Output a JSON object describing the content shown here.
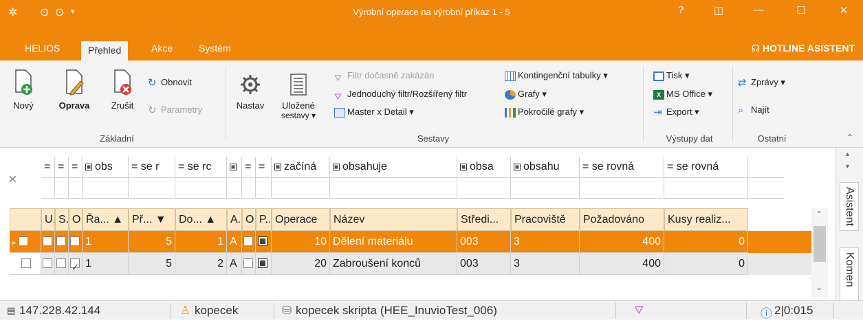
{
  "window": {
    "title": "Výrobní operace na výrobní příkaz 1 - 5",
    "help": "?",
    "minimize": "—",
    "maximize": "☐",
    "close": "✕"
  },
  "menu": {
    "items": [
      "HELIOS",
      "Přehled",
      "Akce",
      "Systém"
    ],
    "active": "Přehled",
    "hotline": "HOTLINE ASISTENT"
  },
  "ribbon": {
    "zakladni": {
      "novy": "Nový",
      "oprava": "Oprava",
      "zrusit": "Zrušit",
      "obnovit": "Obnovit",
      "parametry": "Parametry",
      "group": "Základní"
    },
    "sestavy": {
      "nastav": "Nastav",
      "ulozene1": "Uložené",
      "ulozene2": "sestavy ▾",
      "filtr_disabled": "Filtr dočasně zakázán",
      "jednoduchy": "Jednoduchý filtr/Rozšířený filtr",
      "master": "Master x Detail ▾",
      "kontingencni": "Kontingenční tabulky ▾",
      "grafy": "Grafy ▾",
      "pokrocile": "Pokročilé grafy ▾",
      "group": "Sestavy"
    },
    "vystupy": {
      "tisk": "Tisk ▾",
      "msoffice": "MS Office ▾",
      "export": "Export ▾",
      "group": "Výstupy dat"
    },
    "ostatni": {
      "zpravy": "Zprávy ▾",
      "najit": "Najít",
      "group": "Ostatní"
    }
  },
  "filter": {
    "clear": "×",
    "operators": [
      "=",
      "=",
      "=",
      "obs",
      "= se r",
      "= se rc",
      "",
      "=",
      "=",
      "začíná",
      "obsahuje",
      "obsa",
      "obsahu",
      "= se rovná",
      "= se rovná"
    ]
  },
  "grid": {
    "headers": [
      "U..",
      "S...",
      "O..",
      "Řa... ▲",
      "Př... ▼",
      "Do... ▲",
      "A..",
      "O..",
      "P...",
      "Operace",
      "Název",
      "Středi...",
      "Pracoviště",
      "Požadováno",
      "Kusy realiz..."
    ],
    "rows": [
      {
        "row": "1",
        "pr": "5",
        "do": "1",
        "a": "A",
        "operace": "10",
        "nazev": "Dělení materiálu",
        "stredisko": "003",
        "pracoviste": "3",
        "pozadovano": "400",
        "kusy": "0"
      },
      {
        "row": "1",
        "pr": "5",
        "do": "2",
        "a": "A",
        "operace": "20",
        "nazev": "Zabroušení konců",
        "stredisko": "003",
        "pracoviste": "3",
        "pozadovano": "400",
        "kusy": "0"
      }
    ]
  },
  "side": {
    "asistent": "Asistent",
    "komentar": "Komen"
  },
  "status": {
    "ip": "147.228.42.144",
    "user": "kopecek",
    "db": "kopecek skripta (HEE_InuvioTest_006)",
    "counter": "2|0:015"
  },
  "colors": {
    "accent": "#f0860a",
    "header_bg": "#fde8c8",
    "selected_row": "#f0860a"
  }
}
